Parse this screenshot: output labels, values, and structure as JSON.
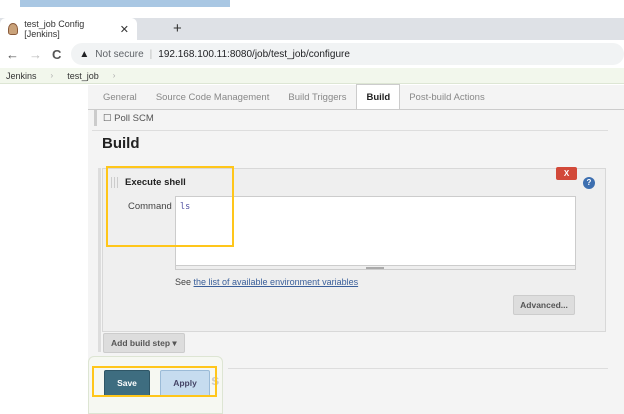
{
  "browser": {
    "tab_title": "test_job Config [Jenkins]",
    "close": "✕",
    "new_tab": "+",
    "back": "←",
    "forward": "→",
    "reload": "C",
    "security": "Not secure",
    "url": "192.168.100.11:8080/job/test_job/configure"
  },
  "breadcrumbs": [
    {
      "label": "Jenkins"
    },
    {
      "label": "test_job"
    }
  ],
  "breadcrumb_sep": "›",
  "config_tabs": [
    {
      "label": "General",
      "active": false
    },
    {
      "label": "Source Code Management",
      "active": false
    },
    {
      "label": "Build Triggers",
      "active": false
    },
    {
      "label": "Build",
      "active": true
    },
    {
      "label": "Post-build Actions",
      "active": false
    }
  ],
  "poll_scm": "Poll SCM",
  "section_title": "Build",
  "step": {
    "title": "Execute shell",
    "delete_label": "X",
    "help": "?",
    "command_label": "Command",
    "command_value": "ls",
    "env_prefix": "See ",
    "env_link": "the list of available environment variables",
    "advanced_label": "Advanced..."
  },
  "add_build_step": "Add build step",
  "add_build_step_caret": "▾",
  "ghost_heading": "Post-build Actions",
  "save_label": "Save",
  "apply_label": "Apply",
  "colors": {
    "highlight": "#ffc61a",
    "save": "#3e6d80",
    "apply": "#c6dcef",
    "delete": "#d24939"
  }
}
